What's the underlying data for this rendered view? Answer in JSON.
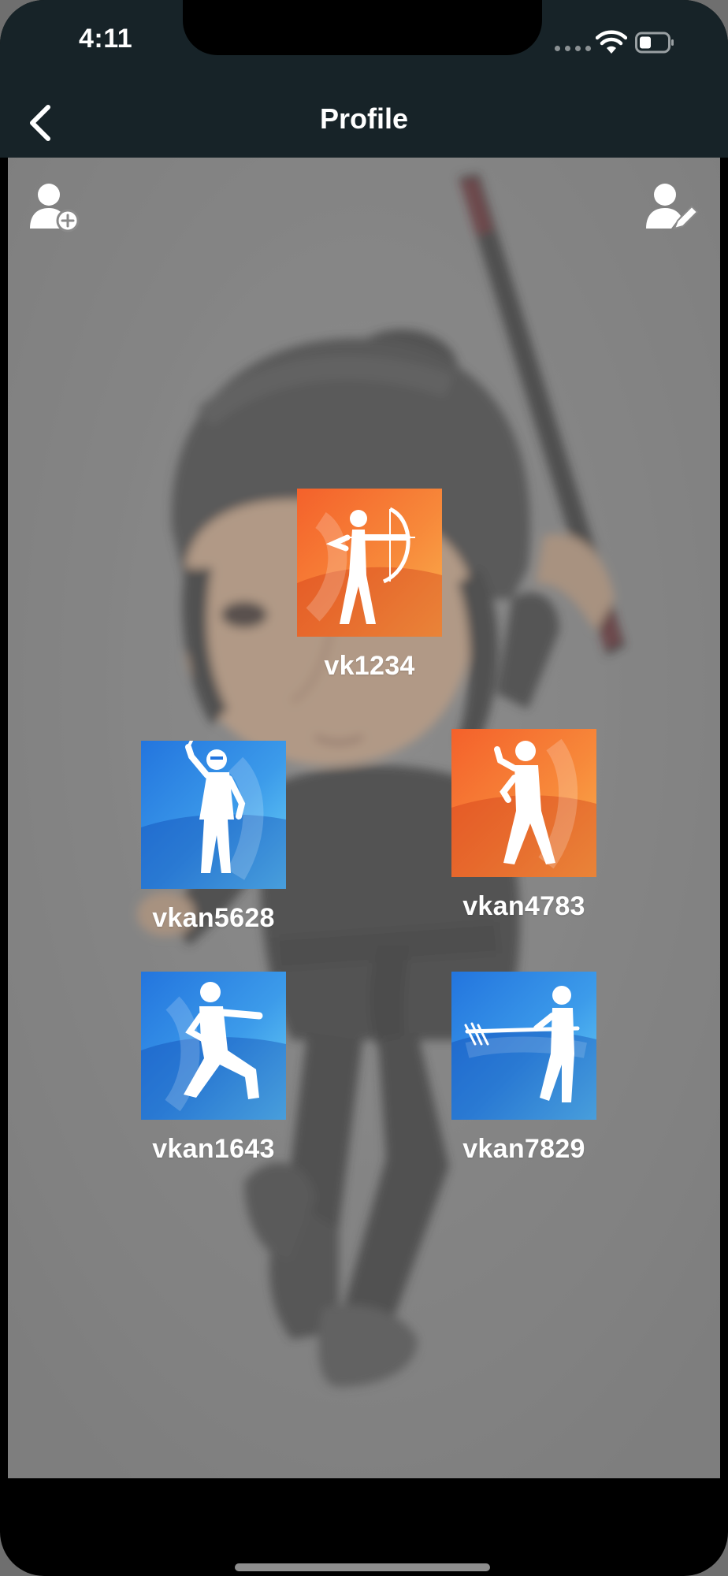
{
  "status_bar": {
    "time": "4:11"
  },
  "nav": {
    "title": "Profile",
    "back_icon": "chevron-left-icon"
  },
  "actions": {
    "add_user_icon": "add-user-icon",
    "edit_user_icon": "edit-user-icon"
  },
  "profiles": [
    {
      "username": "vk1234",
      "tile_color": "#f4612b",
      "figure_icon": "archer-icon"
    },
    {
      "username": "vkan5628",
      "tile_color": "#2375de",
      "figure_icon": "ninja-sword-icon"
    },
    {
      "username": "vkan4783",
      "tile_color": "#f4612b",
      "figure_icon": "martial-stance-icon"
    },
    {
      "username": "vkan1643",
      "tile_color": "#2375de",
      "figure_icon": "karate-punch-icon"
    },
    {
      "username": "vkan7829",
      "tile_color": "#2375de",
      "figure_icon": "spear-fighter-icon"
    }
  ],
  "colors": {
    "header_bg": "#172328",
    "orange_tile": "#f4612b",
    "blue_tile": "#2375de"
  }
}
